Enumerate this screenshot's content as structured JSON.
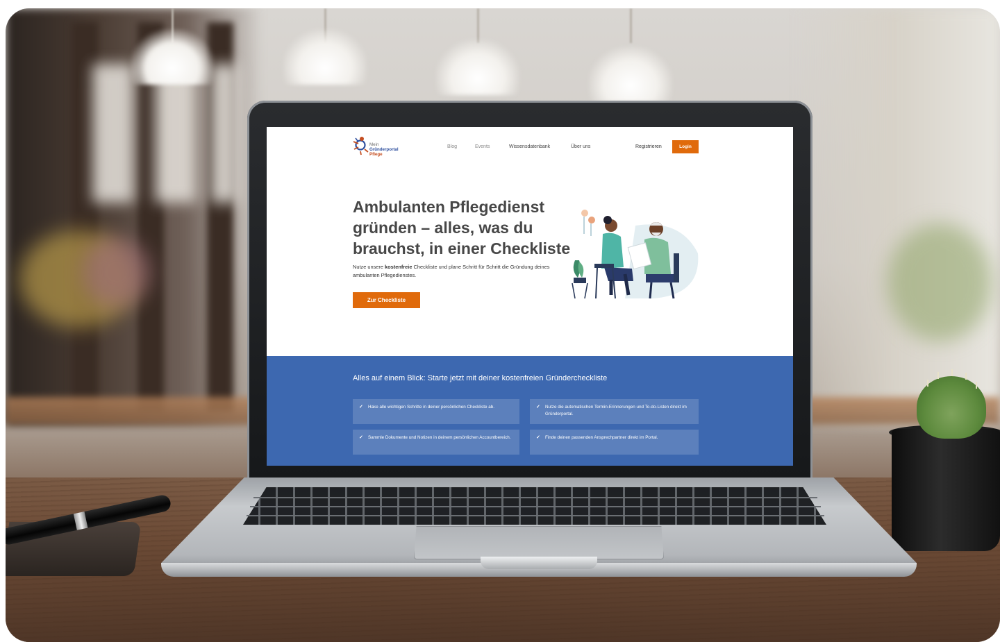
{
  "site": {
    "logo": {
      "line1": "Mein",
      "line2": "Gründerportal",
      "line3": "Pflege"
    },
    "nav": {
      "links": [
        "Blog",
        "Events",
        "Wissensdatenbank",
        "Über uns"
      ],
      "register_label": "Registrieren",
      "login_label": "Login"
    },
    "hero": {
      "title": "Ambulanten Pflegedienst gründen – alles, was du brauchst, in einer Checkliste",
      "text_before": "Nutze unsere ",
      "text_bold": "kostenfreie",
      "text_after": " Checkliste und plane Schritt für Schritt die Gründung deines ambulanten Pflegedienstes.",
      "button_label": "Zur Checkliste"
    },
    "features_section": {
      "title": "Alles auf einem Blick: Starte jetzt mit deiner kostenfreien Gründercheckliste",
      "items": [
        "Hake alle wichtigen Schritte in deiner persönlichen Checkliste ab.",
        "Nutze die automatischen Termin-Erinnerungen und To-do-Listen direkt im Gründerportal.",
        "Sammle Dokumente und Notizen in deinem persönlichen Accountbereich.",
        "Finde deinen passenden Ansprechpartner direkt im Portal."
      ]
    },
    "colors": {
      "accent_orange": "#e06a0b",
      "section_blue": "#3d68b0",
      "title_gray": "#474747",
      "logo_blue": "#2e4f9e",
      "logo_red": "#c44d1f"
    }
  }
}
